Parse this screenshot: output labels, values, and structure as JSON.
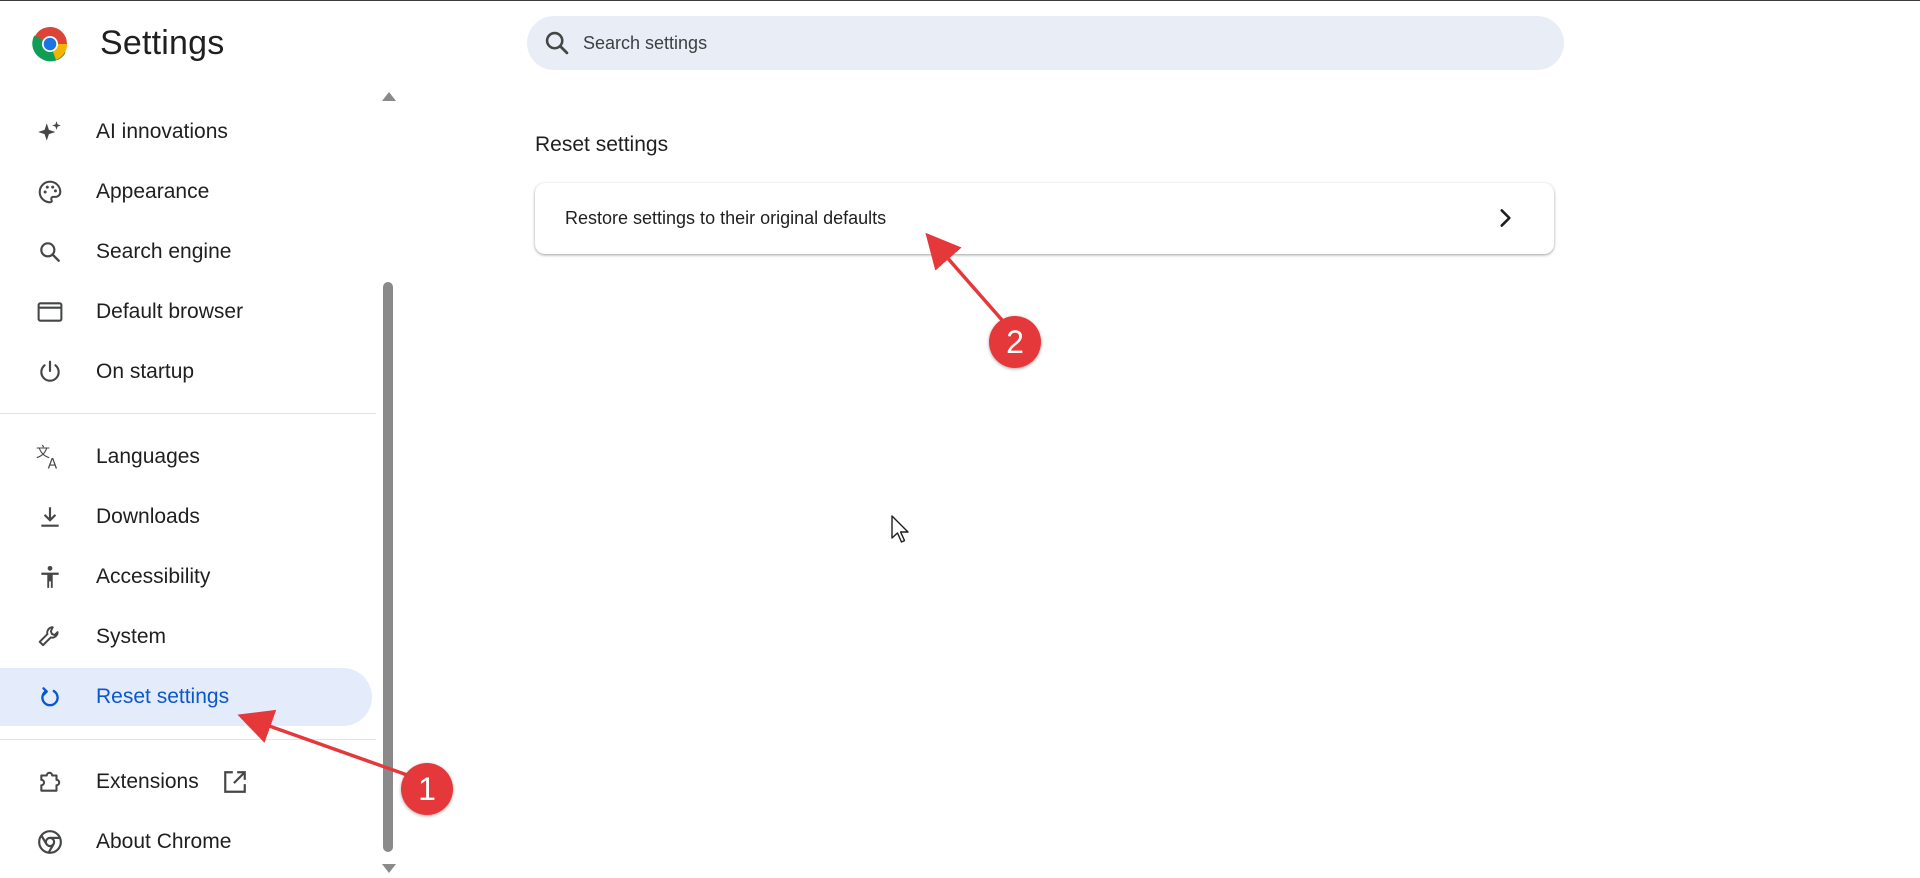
{
  "app": {
    "title": "Settings"
  },
  "search": {
    "placeholder": "Search settings",
    "value": ""
  },
  "sidebar": {
    "items": [
      {
        "label": "AI innovations",
        "icon": "sparkle-icon"
      },
      {
        "label": "Appearance",
        "icon": "palette-icon"
      },
      {
        "label": "Search engine",
        "icon": "search-icon"
      },
      {
        "label": "Default browser",
        "icon": "browser-window-icon"
      },
      {
        "label": "On startup",
        "icon": "power-icon"
      },
      {
        "label": "Languages",
        "icon": "translate-icon"
      },
      {
        "label": "Downloads",
        "icon": "download-icon"
      },
      {
        "label": "Accessibility",
        "icon": "accessibility-icon"
      },
      {
        "label": "System",
        "icon": "wrench-icon"
      },
      {
        "label": "Reset settings",
        "icon": "reset-icon",
        "active": true
      },
      {
        "label": "Extensions",
        "icon": "extension-puzzle-icon"
      },
      {
        "label": "About Chrome",
        "icon": "chrome-icon"
      }
    ]
  },
  "main": {
    "section_title": "Reset settings",
    "card_label": "Restore settings to their original defaults"
  },
  "annotations": {
    "badge1": "1",
    "badge2": "2"
  },
  "colors": {
    "accent": "#0b57d0",
    "active_bg": "#e4ecfb",
    "search_bg": "#e9eef6",
    "annotation": "#e5383b"
  }
}
